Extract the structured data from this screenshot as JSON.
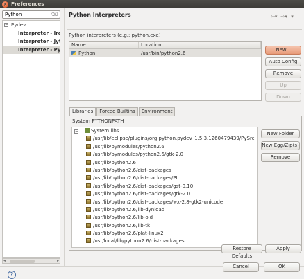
{
  "window": {
    "title": "Preferences",
    "close_glyph": "×"
  },
  "sidebar": {
    "filter_value": "Python",
    "filter_clear_glyph": "⌫",
    "tree": {
      "root_label": "Pydev",
      "root_expander": "−",
      "children": [
        "Interpreter - Iro",
        "Interpreter - Jytl",
        "Interpreter - Py"
      ]
    },
    "scroll_left_glyph": "◂",
    "scroll_right_glyph": "▸"
  },
  "page": {
    "title": "Python Interpreters",
    "nav": {
      "back_glyph": "⇦▾",
      "forward_glyph": "⇨▾",
      "menu_glyph": "▾"
    },
    "description": "Python interpreters (e.g.: python.exe)",
    "table": {
      "columns": [
        "Name",
        "Location"
      ],
      "rows": [
        {
          "name": "Python",
          "location": "/usr/bin/python2.6"
        }
      ]
    },
    "buttons": {
      "new": "New...",
      "auto_config": "Auto Config",
      "remove": "Remove",
      "up": "Up",
      "down": "Down"
    },
    "tabs": [
      "Libraries",
      "Forced Builtins",
      "Environment"
    ],
    "libraries": {
      "label": "System PYTHONPATH",
      "root": "System libs",
      "root_expander": "−",
      "items": [
        "/usr/lib/eclipse/plugins/org.python.pydev_1.5.3.1260479439/PySrc",
        "/usr/lib/pymodules/python2.6",
        "/usr/lib/pymodules/python2.6/gtk-2.0",
        "/usr/lib/python2.6",
        "/usr/lib/python2.6/dist-packages",
        "/usr/lib/python2.6/dist-packages/PIL",
        "/usr/lib/python2.6/dist-packages/gst-0.10",
        "/usr/lib/python2.6/dist-packages/gtk-2.0",
        "/usr/lib/python2.6/dist-packages/wx-2.8-gtk2-unicode",
        "/usr/lib/python2.6/lib-dynload",
        "/usr/lib/python2.6/lib-old",
        "/usr/lib/python2.6/lib-tk",
        "/usr/lib/python2.6/plat-linux2",
        "/usr/local/lib/python2.6/dist-packages"
      ],
      "buttons": {
        "new_folder": "New Folder",
        "new_egg": "New Egg/Zip(s)",
        "remove": "Remove"
      }
    },
    "restore_defaults": "Restore Defaults",
    "apply": "Apply"
  },
  "footer": {
    "help_glyph": "?",
    "cancel": "Cancel",
    "ok": "OK"
  }
}
